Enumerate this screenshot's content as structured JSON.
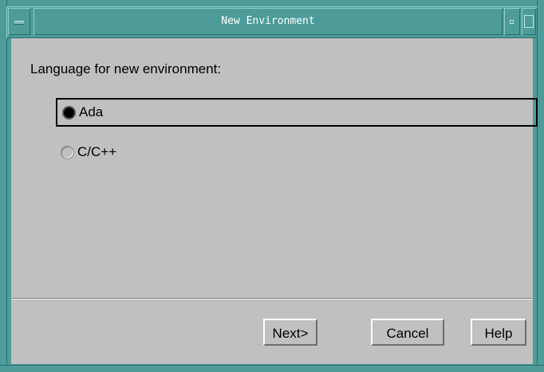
{
  "window": {
    "title": "New Environment"
  },
  "dialog": {
    "prompt": "Language for new environment:",
    "options": [
      {
        "label": "Ada",
        "selected": true
      },
      {
        "label": "C/C++",
        "selected": false
      }
    ]
  },
  "buttons": {
    "next": "Next>",
    "cancel": "Cancel",
    "help": "Help"
  },
  "icons": {
    "window_menu": "window-menu-icon",
    "minimize": "minimize-icon",
    "maximize": "maximize-icon"
  },
  "colors": {
    "frame": "#4d9c9a",
    "title_text": "#ffffff",
    "dialog_bg": "#c0c0c0"
  }
}
